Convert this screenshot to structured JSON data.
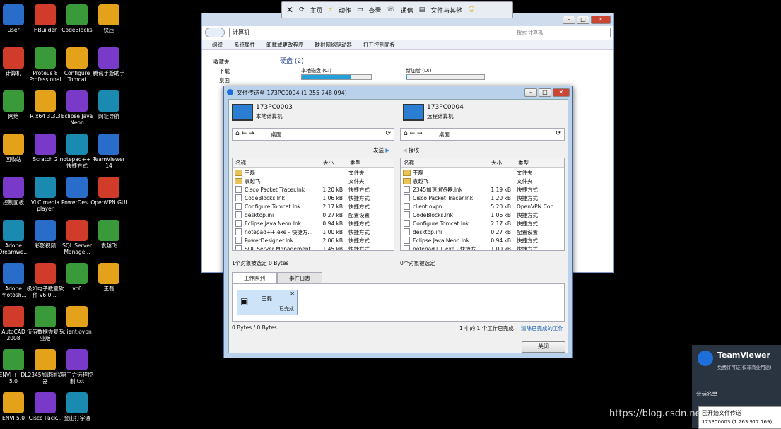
{
  "desktop": {
    "col1": [
      "User",
      "计算机",
      "网络",
      "回收站",
      "控制面板",
      "Adobe Dreamwe...",
      "Adobe Photosh...",
      "AutoCAD 2008",
      "ENVI + IDL 5.0",
      "ENVI 5.0"
    ],
    "col2": [
      "HBuilder",
      "Proteus 8 Professional",
      "R x64 3.3.3",
      "Scratch 2",
      "VLC media player",
      "彩影视频",
      "极如电子教室软件 v6.0 ...",
      "伍佰数据恢复专业版",
      "2345加速浏览器",
      "Cisco Pack..."
    ],
    "col3": [
      "CodeBlocks",
      "Configure Tomcat",
      "Eclipse Java Neon",
      "notepad++ - 快捷方式",
      "PowerDes...",
      "SQL Server Manage...",
      "vc6",
      "client.ovpn",
      "第三方远程控制.txt",
      "金山打字通"
    ],
    "col4": [
      "快压",
      "腾讯手游助手",
      "网址导航",
      "TeamViewer 14",
      "OpenVPN GUI",
      "袁越飞",
      "王磊"
    ]
  },
  "toolbar": {
    "home": "主页",
    "actions": "动作",
    "view": "查看",
    "comm": "通信",
    "files": "文件与其他"
  },
  "explorer": {
    "address": "计算机",
    "search_placeholder": "搜索 计算机",
    "menu": [
      "组织",
      "系统属性",
      "卸载或更改程序",
      "映射网络驱动器",
      "打开控制面板"
    ],
    "nav": [
      "收藏夹",
      "下载",
      "桌面"
    ],
    "section": "硬盘 (2)",
    "drive1": "本地磁盘 (C:)",
    "drive2": "新加卷 (D:)",
    "drive1_sub": "20.7 GB 可用，共 29.9 GB",
    "drive2_sub": "18.9 GB 可用，共 19.0 GB"
  },
  "dialog": {
    "title": "文件传送至 173PC0004 (1 255 748 094)",
    "local_id": "173PC0003",
    "local_label": "本地计算机",
    "remote_id": "173PC0004",
    "remote_label": "远程计算机",
    "path": "桌面",
    "send": "发送",
    "receive": "接收",
    "headers": {
      "name": "名称",
      "size": "大小",
      "type": "类型"
    },
    "left_files": [
      {
        "name": "王磊",
        "size": "",
        "type": "文件夹"
      },
      {
        "name": "袁越飞",
        "size": "",
        "type": "文件夹"
      },
      {
        "name": "Cisco Packet Tracer.lnk",
        "size": "1.20 kB",
        "type": "快捷方式"
      },
      {
        "name": "CodeBlocks.lnk",
        "size": "1.06 kB",
        "type": "快捷方式"
      },
      {
        "name": "Configure Tomcat.lnk",
        "size": "2.17 kB",
        "type": "快捷方式"
      },
      {
        "name": "desktop.ini",
        "size": "0.27 kB",
        "type": "配置设置"
      },
      {
        "name": "Eclipse Java Neon.lnk",
        "size": "0.94 kB",
        "type": "快捷方式"
      },
      {
        "name": "notepad++.exe - 快捷方...",
        "size": "1.00 kB",
        "type": "快捷方式"
      },
      {
        "name": "PowerDesigner.lnk",
        "size": "2.06 kB",
        "type": "快捷方式"
      },
      {
        "name": "SQL Server Management...",
        "size": "1.45 kB",
        "type": "快捷方式"
      }
    ],
    "right_files": [
      {
        "name": "王磊",
        "size": "",
        "type": "文件夹"
      },
      {
        "name": "袁越飞",
        "size": "",
        "type": "文件夹"
      },
      {
        "name": "2345加速浏览器.lnk",
        "size": "1.19 kB",
        "type": "快捷方式"
      },
      {
        "name": "Cisco Packet Tracer.lnk",
        "size": "1.20 kB",
        "type": "快捷方式"
      },
      {
        "name": "client.ovpn",
        "size": "5.20 kB",
        "type": "OpenVPN Con..."
      },
      {
        "name": "CodeBlocks.lnk",
        "size": "1.06 kB",
        "type": "快捷方式"
      },
      {
        "name": "Configure Tomcat.lnk",
        "size": "2.17 kB",
        "type": "快捷方式"
      },
      {
        "name": "desktop.ini",
        "size": "0.27 kB",
        "type": "配置设置"
      },
      {
        "name": "Eclipse Java Neon.lnk",
        "size": "0.94 kB",
        "type": "快捷方式"
      },
      {
        "name": "notepad++.exe - 快捷方...",
        "size": "1.00 kB",
        "type": "快捷方式"
      }
    ],
    "left_status": "1个对象被选定 0 Bytes",
    "right_status": "0个对象被选定",
    "tab_queue": "工作队列",
    "tab_log": "事件日志",
    "queue_item": "王磊",
    "queue_done": "已完成",
    "bytes": "0 Bytes / 0 Bytes",
    "progress_text": "1 中的 1 个工作已完成",
    "clear_link": "清除已完成的工作",
    "close": "关闭"
  },
  "teamviewer": {
    "brand": "TeamViewer",
    "sub": "免费许可证(仅非商业用途)",
    "session": "会话名单"
  },
  "notification": {
    "title": "已开始文件传送",
    "detail": "173PC0003 (1 263 917 769)"
  },
  "watermark": "https://blog.csdn.net/..."
}
